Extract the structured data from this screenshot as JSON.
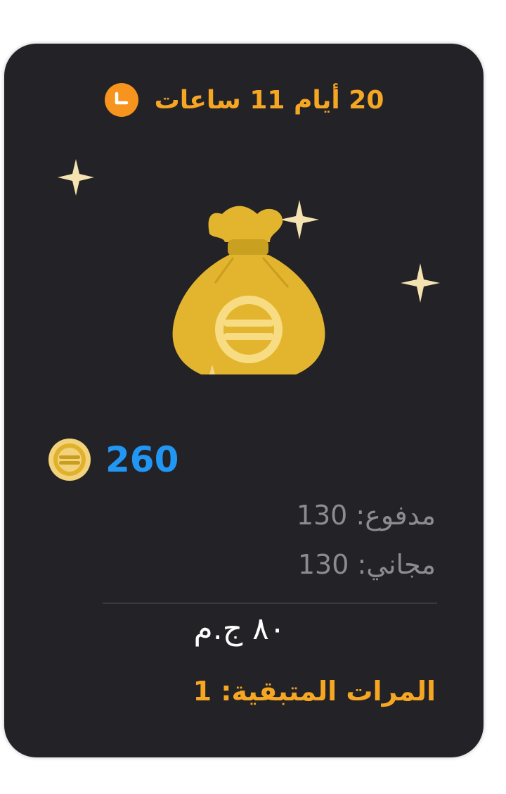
{
  "offer": {
    "timer_text": "20 أيام 11 ساعات",
    "coin_amount": "260",
    "paid_text": "مدفوع: 130",
    "free_text": "مجاني: 130",
    "price_text": "٨٠ ج.م",
    "remaining_text": "المرات المتبقية: 1"
  },
  "icons": {
    "clock": "clock-icon",
    "money_bag": "money-bag-icon",
    "sparkle": "sparkle-icon",
    "coin": "coin-icon"
  },
  "colors": {
    "card_background": "#232227",
    "accent_orange": "#f5a623",
    "coin_blue": "#2196f3",
    "gold": "#e0b12c",
    "muted_text": "#8c8c90",
    "price_text": "#ffffff"
  }
}
